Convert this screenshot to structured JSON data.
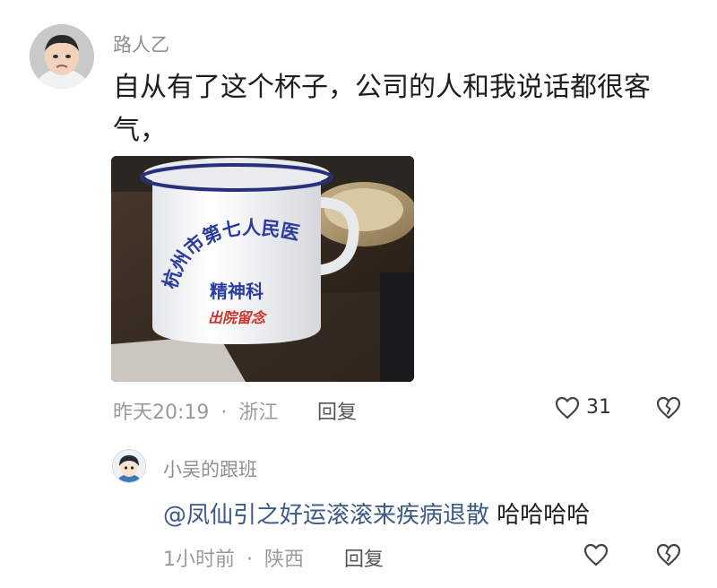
{
  "comment": {
    "username": "路人乙",
    "text": "自从有了这个杯子，公司的人和我说话都很客气，",
    "image": {
      "mug_text_line1": "杭州市第七人民医院",
      "mug_text_line2": "精神科",
      "mug_text_line3": "出院留念"
    },
    "time": "昨天20:19",
    "separator": "·",
    "location": "浙江",
    "reply_label": "回复",
    "like_count": "31",
    "icons": [
      "heart-icon",
      "broken-heart-icon"
    ]
  },
  "reply": {
    "username": "小吴的跟班",
    "mention": "@凤仙引之好运滚滚来疾病退散",
    "text": " 哈哈哈哈",
    "time": "1小时前",
    "separator": "·",
    "location": "陕西",
    "reply_label": "回复",
    "icons": [
      "heart-icon",
      "broken-heart-icon"
    ]
  },
  "colors": {
    "text_primary": "#1d1d1d",
    "text_secondary": "#9a9a9a",
    "mention": "#3c5a86",
    "mug_blue": "#2b3c9e",
    "mug_red": "#d0322a"
  }
}
